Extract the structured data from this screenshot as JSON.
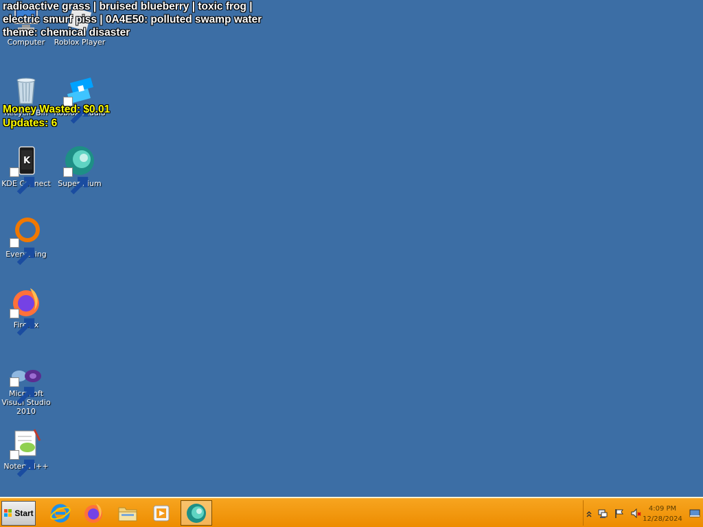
{
  "overlay": {
    "line1": "radioactive grass | bruised blueberry | toxic frog |",
    "line2": "electric smurf piss | 0A4E50: polluted swamp water",
    "line3": "theme: chemical disaster",
    "money": "Money Wasted: $0.01",
    "updates": "Updates: 6"
  },
  "desktop": {
    "icons": [
      {
        "label": "Computer",
        "icon": "computer-icon"
      },
      {
        "label": "Roblox Player",
        "icon": "roblox-player-icon"
      },
      {
        "label": "Recycle Bin",
        "icon": "recycle-bin-icon"
      },
      {
        "label": "Roblox Studio",
        "icon": "roblox-studio-icon"
      },
      {
        "label": "KDE Connect",
        "icon": "kde-connect-icon"
      },
      {
        "label": "Supermium",
        "icon": "supermium-icon"
      },
      {
        "label": "Everything",
        "icon": "everything-icon"
      },
      {
        "label": "Firefox",
        "icon": "firefox-icon"
      },
      {
        "label": "Microsoft Visual Studio 2010",
        "icon": "visual-studio-icon"
      },
      {
        "label": "Notepad++",
        "icon": "notepad-plus-plus-icon"
      }
    ]
  },
  "taskbar": {
    "start_label": "Start",
    "pinned": [
      "internet-explorer-icon",
      "firefox-icon",
      "file-explorer-icon",
      "media-player-icon",
      "supermium-icon"
    ],
    "clock_time": "4:09 PM",
    "clock_date": "12/28/2024"
  },
  "colors": {
    "desktop_background": "#3c6ea5",
    "taskbar": "#ed8c00",
    "overlay_highlight": "#ffff00"
  }
}
